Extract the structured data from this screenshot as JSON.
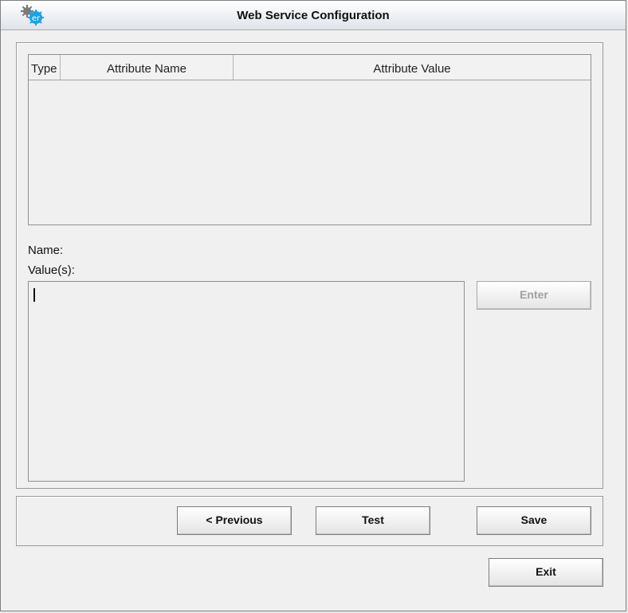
{
  "window": {
    "title": "Web Service Configuration",
    "icon": "gear-er-icon",
    "icon_text": "er"
  },
  "table": {
    "columns": [
      "Type",
      "Attribute Name",
      "Attribute Value"
    ],
    "rows": []
  },
  "form": {
    "name_label": "Name:",
    "values_label": "Value(s):",
    "values_value": ""
  },
  "buttons": {
    "enter": "Enter",
    "previous": "< Previous",
    "test": "Test",
    "save": "Save",
    "exit": "Exit"
  },
  "colors": {
    "window_bg": "#f0f0f0",
    "disabled_text": "#a0a0a0",
    "icon_blue": "#1aa3e8"
  }
}
